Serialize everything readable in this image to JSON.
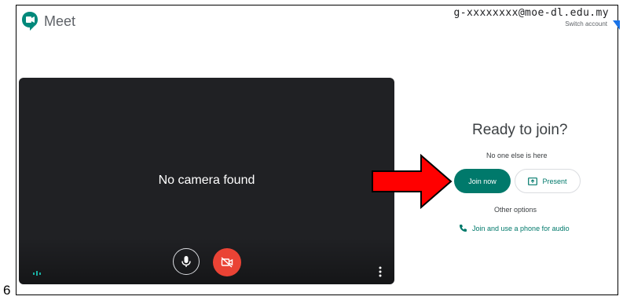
{
  "header": {
    "app_name": "Meet",
    "account_email": "g-xxxxxxxx@moe-dl.edu.my",
    "switch_account": "Switch account"
  },
  "video": {
    "status_text": "No camera found"
  },
  "join_panel": {
    "title": "Ready to join?",
    "participants_text": "No one else is here",
    "join_now_label": "Join now",
    "present_label": "Present",
    "other_options_label": "Other options",
    "phone_audio_label": "Join and use a phone for audio"
  },
  "page_number": "6",
  "colors": {
    "accent": "#00796b",
    "camera_off": "#ea4335",
    "video_bg": "#202124",
    "annotation_arrow": "#ff0000"
  },
  "icons": {
    "logo": "meet-logo-icon",
    "mic": "microphone-icon",
    "camera": "camera-off-icon",
    "present": "present-screen-icon",
    "phone": "phone-icon",
    "more": "more-vert-icon",
    "audio": "audio-level-icon"
  }
}
